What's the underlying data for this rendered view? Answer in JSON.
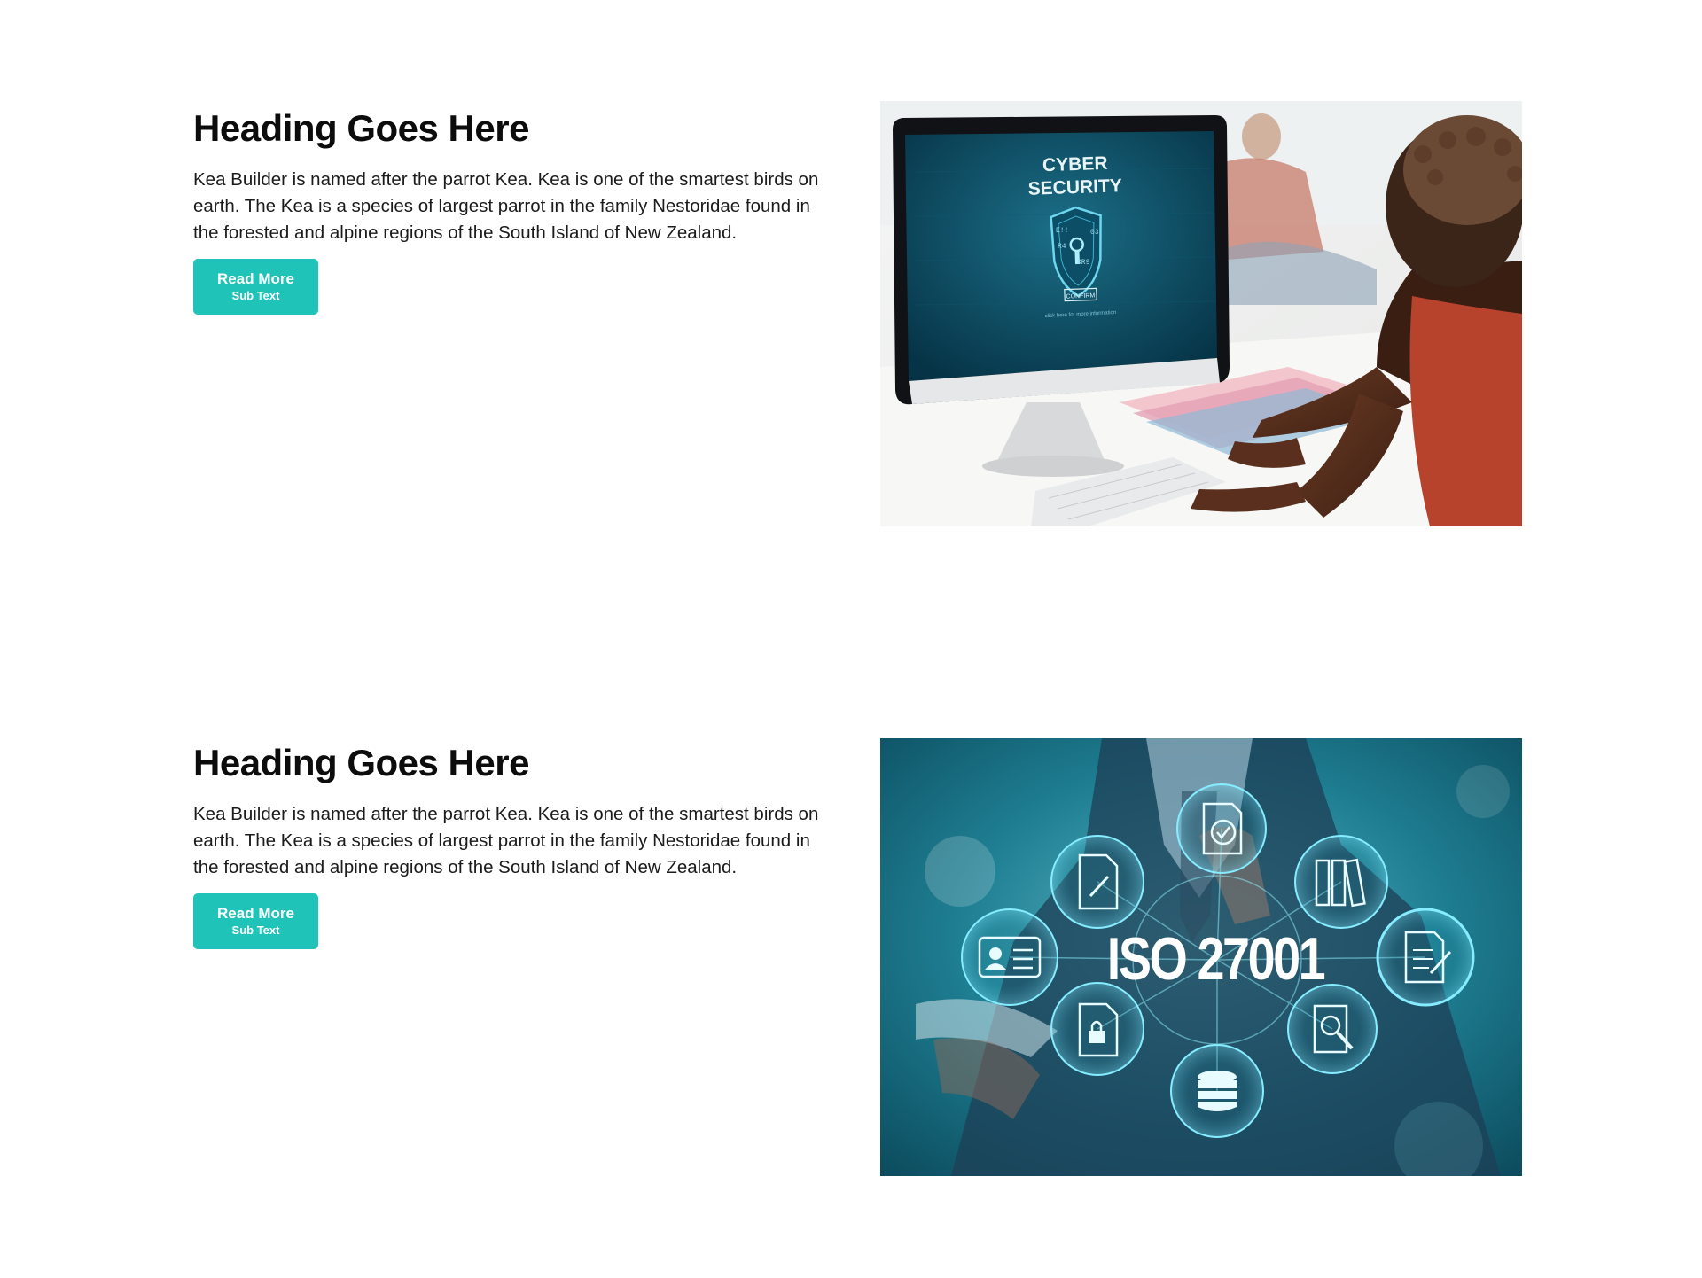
{
  "sections": [
    {
      "heading": "Heading Goes Here",
      "body": "Kea Builder is named after the parrot Kea. Kea is one of the smartest birds on earth. The Kea is a species of largest parrot in the family Nestoridae found in the forested and alpine regions of the South Island of New Zealand.",
      "button": {
        "label": "Read More",
        "sub_label": "Sub Text"
      },
      "image": {
        "screen_title_line1": "CYBER",
        "screen_title_line2": "SECURITY",
        "screen_button": "CONFIRM",
        "screen_caption": "click here for more information",
        "shield_codes": [
          "E!!",
          "03",
          "R4",
          "XR9"
        ]
      }
    },
    {
      "heading": "Heading Goes Here",
      "body": "Kea Builder is named after the parrot Kea. Kea is one of the smartest birds on earth. The Kea is a species of largest parrot in the family Nestoridae found in the forested and alpine regions of the South Island of New Zealand.",
      "button": {
        "label": "Read More",
        "sub_label": "Sub Text"
      },
      "image": {
        "center_text": "ISO 27001",
        "icons": [
          "gear-document-icon",
          "pencil-document-icon",
          "binders-icon",
          "id-card-icon",
          "edit-document-icon",
          "locked-document-icon",
          "audit-clipboard-icon",
          "database-icon"
        ]
      }
    }
  ],
  "colors": {
    "accent": "#1fc3b8",
    "heading": "#0c0c0c",
    "body": "#1b1b1b",
    "background": "#ffffff"
  }
}
